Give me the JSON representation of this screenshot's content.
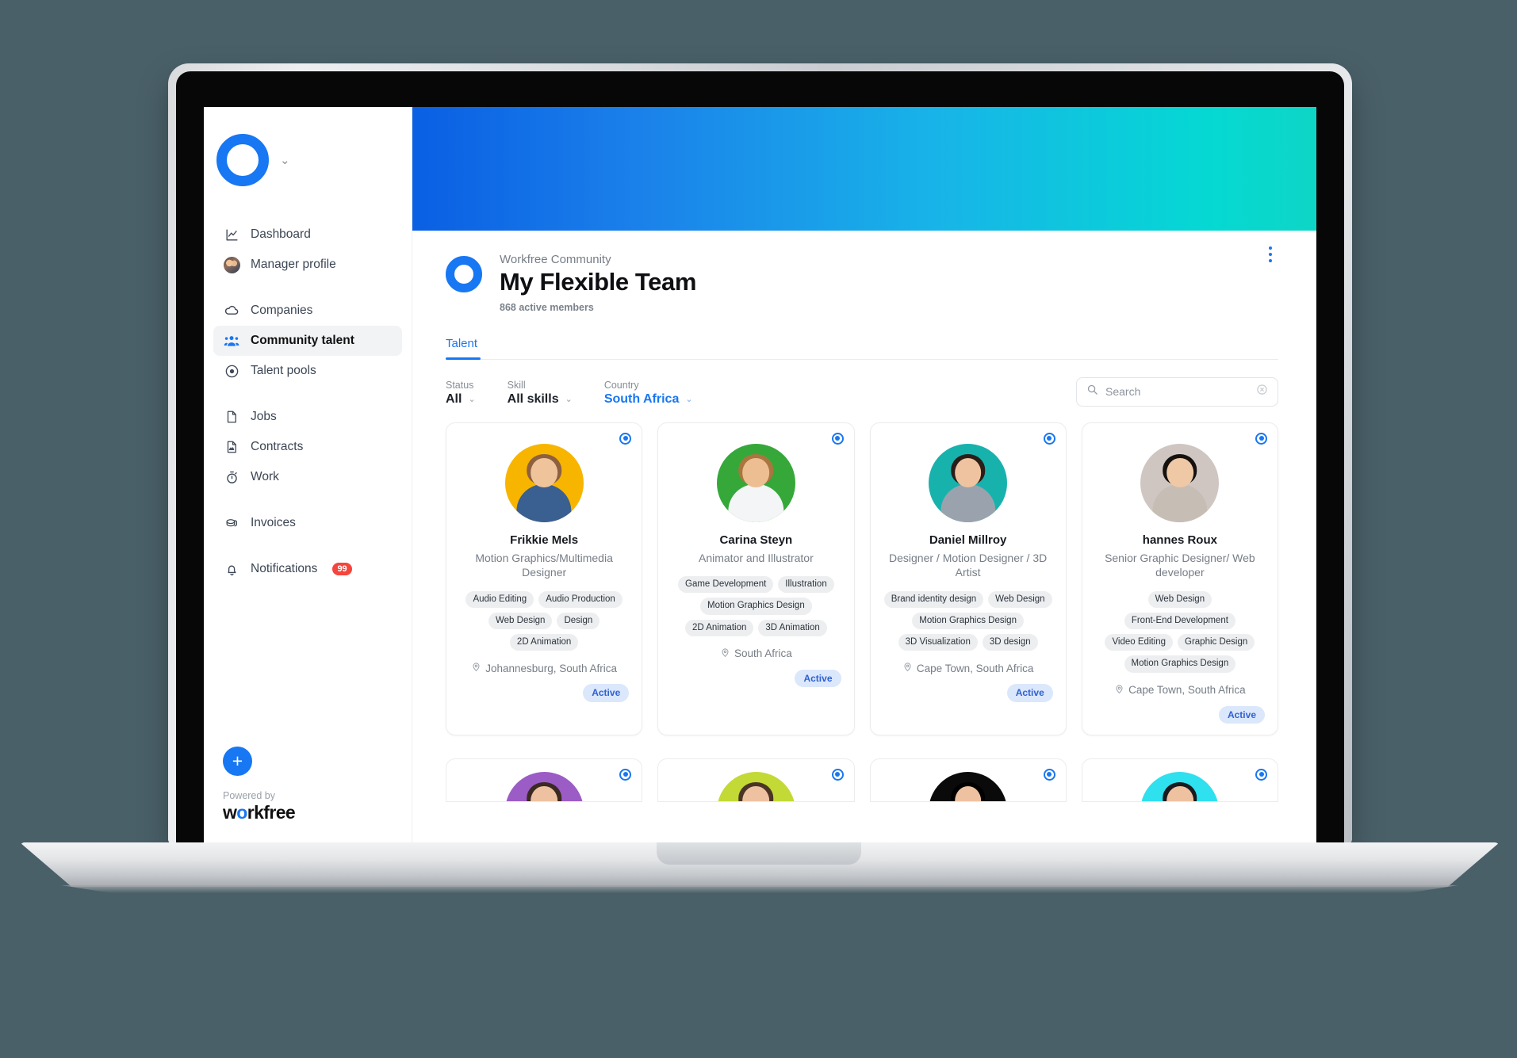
{
  "sidebar": {
    "brand_logo_name": "workfree-ring-logo",
    "brand_chevron": "⌄",
    "groups": [
      {
        "items": [
          {
            "label": "Dashboard",
            "icon": "chart-line-icon"
          },
          {
            "label": "Manager profile",
            "icon": "manager-avatar-icon"
          }
        ]
      },
      {
        "items": [
          {
            "label": "Companies",
            "icon": "cloud-icon"
          },
          {
            "label": "Community talent",
            "icon": "people-group-icon",
            "active": true
          },
          {
            "label": "Talent pools",
            "icon": "target-icon"
          }
        ]
      },
      {
        "items": [
          {
            "label": "Jobs",
            "icon": "document-icon"
          },
          {
            "label": "Contracts",
            "icon": "contract-icon"
          },
          {
            "label": "Work",
            "icon": "stopwatch-icon"
          }
        ]
      },
      {
        "items": [
          {
            "label": "Invoices",
            "icon": "coins-icon"
          }
        ]
      },
      {
        "items": [
          {
            "label": "Notifications",
            "icon": "bell-icon",
            "badge": "99"
          }
        ]
      }
    ],
    "add_button_label": "+",
    "powered_by": "Powered by",
    "logo_part1": "w",
    "logo_part2": "o",
    "logo_part3": "rkfree"
  },
  "header": {
    "banner_gradient_from": "#0a5fe3",
    "banner_gradient_to": "#0ed6c6",
    "community_label": "Workfree Community",
    "title": "My Flexible Team",
    "members": "868 active members",
    "kebab_name": "more-options-icon"
  },
  "tabs": [
    {
      "label": "Talent",
      "active": true
    }
  ],
  "filters": {
    "status": {
      "label": "Status",
      "value": "All"
    },
    "skill": {
      "label": "Skill",
      "value": "All skills"
    },
    "country": {
      "label": "Country",
      "value": "South Africa"
    },
    "chevron": "⌄"
  },
  "search": {
    "placeholder": "Search",
    "value": "",
    "icon": "search-icon",
    "clear_icon": "clear-circle-icon"
  },
  "cards": [
    {
      "name": "Frikkie Mels",
      "role": "Motion Graphics/Multimedia Designer",
      "skills": [
        "Audio Editing",
        "Audio Production",
        "Web Design",
        "Design",
        "2D Animation"
      ],
      "location": "Johannesburg, South Africa",
      "status": "Active",
      "avatar_bg": "#f7b500",
      "avatar_body": "#3a5f91",
      "avatar_skin": "#f0c49a",
      "avatar_hair": "#8d6040",
      "selected": true
    },
    {
      "name": "Carina Steyn",
      "role": "Animator and Illustrator",
      "skills": [
        "Game Development",
        "Illustration",
        "Motion Graphics Design",
        "2D Animation",
        "3D Animation"
      ],
      "location": "South Africa",
      "status": "Active",
      "avatar_bg": "#35a839",
      "avatar_body": "#f4f5f6",
      "avatar_skin": "#edbe92",
      "avatar_hair": "#a9763f",
      "selected": true
    },
    {
      "name": "Daniel Millroy",
      "role": "Designer / Motion Designer / 3D Artist",
      "skills": [
        "Brand identity design",
        "Web Design",
        "Motion Graphics Design",
        "3D Visualization",
        "3D design"
      ],
      "location": "Cape Town, South Africa",
      "status": "Active",
      "avatar_bg": "#18b2ad",
      "avatar_body": "#9aa3ad",
      "avatar_skin": "#f0c3a0",
      "avatar_hair": "#2b1d18",
      "selected": true
    },
    {
      "name": "hannes Roux",
      "role": "Senior Graphic Designer/ Web developer",
      "skills": [
        "Web Design",
        "Front-End Development",
        "Video Editing",
        "Graphic Design",
        "Motion Graphics Design"
      ],
      "location": "Cape Town, South Africa",
      "status": "Active",
      "avatar_bg": "#cfc6c2",
      "avatar_body": "#c6bdb5",
      "avatar_skin": "#efc9a6",
      "avatar_hair": "#15110f",
      "selected": true
    }
  ],
  "cards_row2": [
    {
      "avatar_bg": "#9c5cc6",
      "avatar_hair": "#3a2a22",
      "selected": true
    },
    {
      "avatar_bg": "#c3d935",
      "avatar_hair": "#4a3426",
      "selected": true
    },
    {
      "avatar_bg": "#0a0a0a",
      "avatar_hair": "#000000",
      "selected": true
    },
    {
      "avatar_bg": "#2fe0ee",
      "avatar_hair": "#1b1b1f",
      "selected": true
    }
  ],
  "colors": {
    "accent": "#1877f2",
    "background": "#4a6069",
    "badge_red": "#f5453c",
    "active_pill_bg": "#dbe7fb",
    "active_pill_text": "#2f61d2"
  }
}
